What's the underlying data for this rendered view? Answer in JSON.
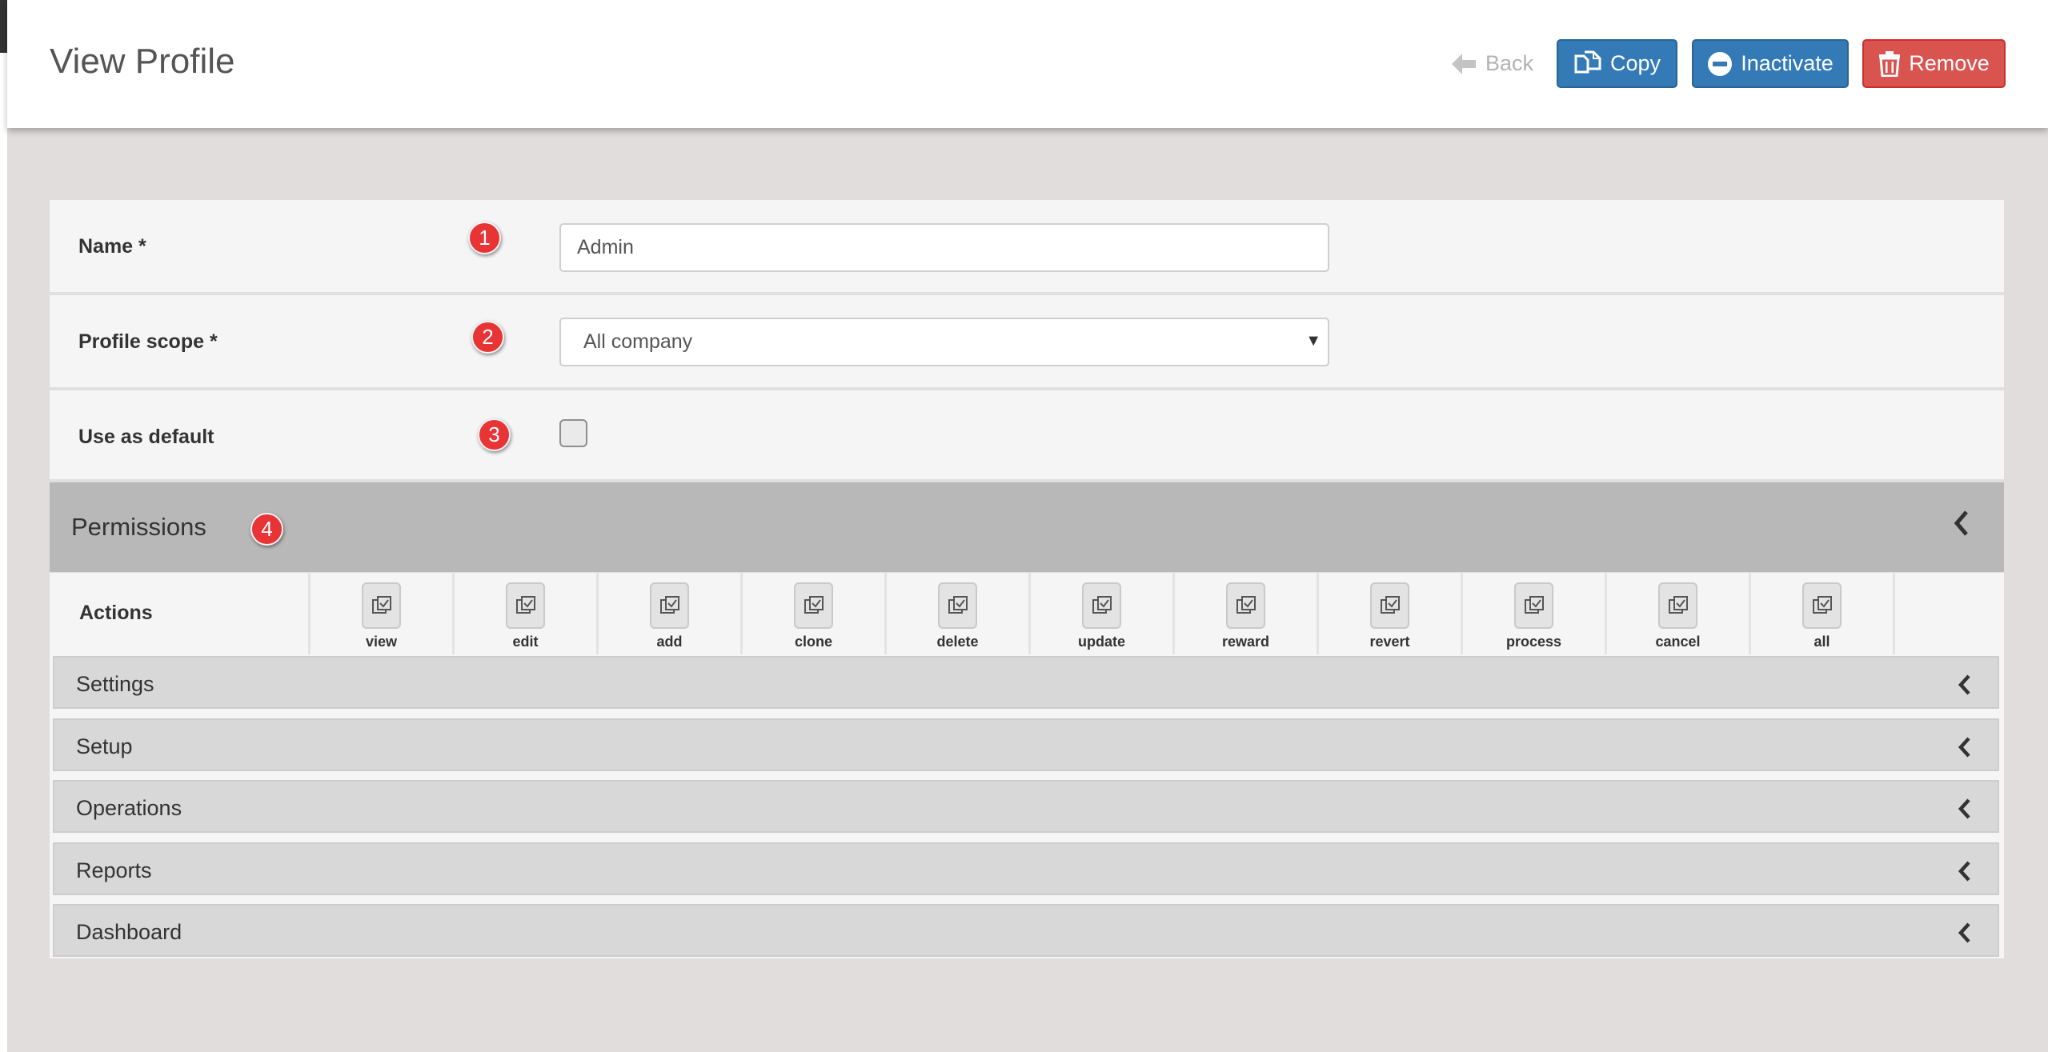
{
  "header": {
    "title": "View Profile",
    "back_label": "Back",
    "copy_label": "Copy",
    "inactivate_label": "Inactivate",
    "remove_label": "Remove"
  },
  "form": {
    "name": {
      "label": "Name *",
      "marker": "1",
      "value": "Admin"
    },
    "scope": {
      "label": "Profile scope *",
      "marker": "2",
      "value": "All company"
    },
    "default": {
      "label": "Use as default",
      "marker": "3",
      "checked": false
    }
  },
  "permissions": {
    "title": "Permissions",
    "marker": "4",
    "actions_label": "Actions",
    "actions": [
      "view",
      "edit",
      "add",
      "clone",
      "delete",
      "update",
      "reward",
      "revert",
      "process",
      "cancel",
      "all"
    ],
    "sections": [
      "Settings",
      "Setup",
      "Operations",
      "Reports",
      "Dashboard"
    ]
  },
  "colors": {
    "primary": "#337ab7",
    "danger": "#d9534f",
    "marker": "#e83434",
    "background": "#e1dddd",
    "panel_header": "#b8b8b8"
  },
  "icons": {
    "back": "arrow-left-icon",
    "copy": "copy-icon",
    "inactivate": "minus-circle-icon",
    "remove": "trash-icon",
    "collapse": "chevron-left-icon",
    "action": "check-square-icon"
  }
}
